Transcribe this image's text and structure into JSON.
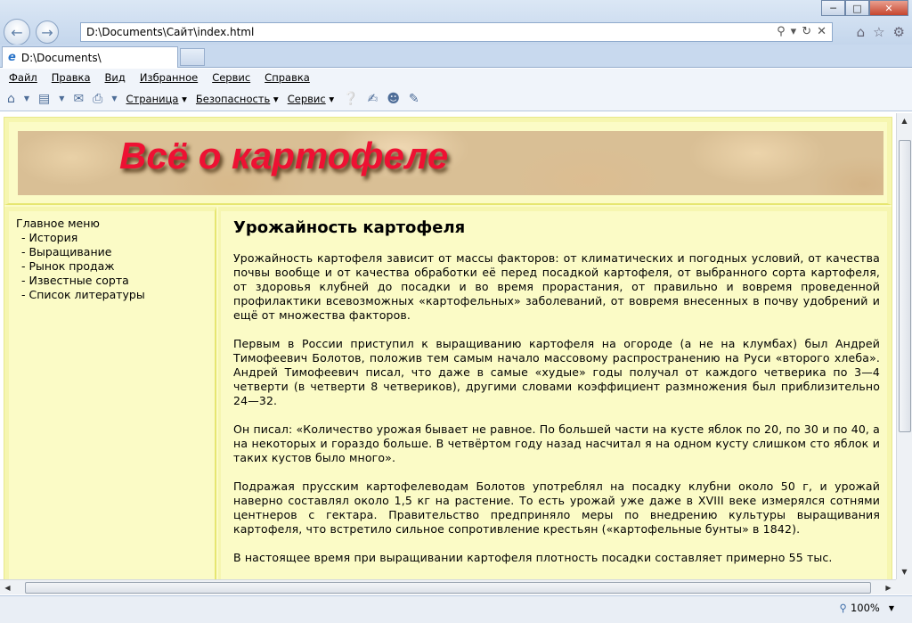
{
  "browser": {
    "address": "D:\\Documents\\Сайт\\index.html",
    "tab_title": "D:\\Documents\\",
    "zoom": "100%"
  },
  "menu": [
    "Файл",
    "Правка",
    "Вид",
    "Избранное",
    "Сервис",
    "Справка"
  ],
  "command_bar": {
    "page": "Страница",
    "security": "Безопасность",
    "tools": "Сервис"
  },
  "site": {
    "title": "Всё о картофеле",
    "title_color": "#ee1133",
    "background_color": "#fbfbc6"
  },
  "sidebar": {
    "heading": "Главное меню",
    "items": [
      "- История",
      "- Выращивание",
      "- Рынок продаж",
      "- Известные сорта",
      "- Список литературы"
    ]
  },
  "content": {
    "heading": "Урожайность картофеля",
    "paragraphs": [
      "Урожайность картофеля зависит от массы факторов: от климатических и погодных условий, от качества почвы вообще и от качества обработки её перед посадкой картофеля, от выбранного сорта картофеля, от здоровья клубней до посадки и во время прорастания, от правильно и вовремя проведенной профилактики всевозможных «картофельных» заболеваний, от вовремя внесенных в почву удобрений и ещё от множества факторов.",
      "Первым в России приступил к выращиванию картофеля на огороде (а не на клумбах) был Андрей Тимофеевич Болотов, положив тем самым начало массовому распространению на Руси «второго хлеба». Андрей Тимофеевич писал, что даже в самые «худые» годы получал от каждого четверика по 3—4 четверти (в четверти 8 четвериков), другими словами коэффициент размножения был приблизительно 24—32.",
      "Он писал: «Количество урожая бывает не равное. По большей части на кусте яблок по 20, по 30 и по 40, а на некоторых и гораздо больше. В четвёртом году назад насчитал я на одном кусту слишком сто яблок и таких кустов было много».",
      "Подражая прусским картофелеводам Болотов употреблял на посадку клубни около 50 г, и урожай наверно составлял около 1,5 кг на растение. То есть урожай уже даже в XVIII веке измерялся сотнями центнеров с гектара. Правительство предприняло меры по внедрению культуры выращивания картофеля, что встретило сильное сопротивление крестьян («картофельные бунты» в 1842).",
      "В настоящее время при выращивании картофеля плотность посадки составляет примерно 55 тыс."
    ]
  }
}
